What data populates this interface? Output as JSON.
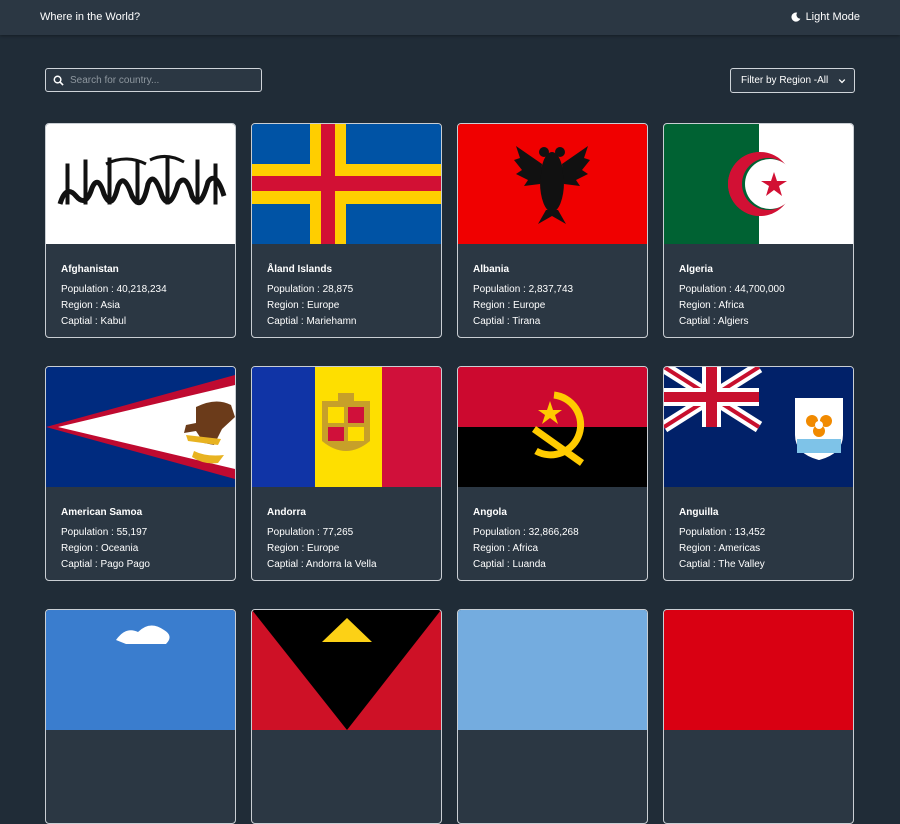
{
  "header": {
    "title": "Where in the World?",
    "theme_label": "Light Mode"
  },
  "search": {
    "placeholder": "Search for country..."
  },
  "filter": {
    "label": "Filter by Region -All"
  },
  "labels": {
    "population": "Population : ",
    "region": "Region : ",
    "capital": "Captial : "
  },
  "countries": [
    {
      "name": "Afghanistan",
      "population": "40,218,234",
      "region": "Asia",
      "capital": "Kabul",
      "flag": "afghanistan-flag"
    },
    {
      "name": "Åland Islands",
      "population": "28,875",
      "region": "Europe",
      "capital": "Mariehamn",
      "flag": "aland-flag"
    },
    {
      "name": "Albania",
      "population": "2,837,743",
      "region": "Europe",
      "capital": "Tirana",
      "flag": "albania-flag"
    },
    {
      "name": "Algeria",
      "population": "44,700,000",
      "region": "Africa",
      "capital": "Algiers",
      "flag": "algeria-flag"
    },
    {
      "name": "American Samoa",
      "population": "55,197",
      "region": "Oceania",
      "capital": "Pago Pago",
      "flag": "american-samoa-flag"
    },
    {
      "name": "Andorra",
      "population": "77,265",
      "region": "Europe",
      "capital": "Andorra la Vella",
      "flag": "andorra-flag"
    },
    {
      "name": "Angola",
      "population": "32,866,268",
      "region": "Africa",
      "capital": "Luanda",
      "flag": "angola-flag"
    },
    {
      "name": "Anguilla",
      "population": "13,452",
      "region": "Americas",
      "capital": "The Valley",
      "flag": "anguilla-flag"
    }
  ],
  "colors": {
    "background": "#202c37",
    "surface": "#2b3743",
    "text": "#ffffff"
  }
}
